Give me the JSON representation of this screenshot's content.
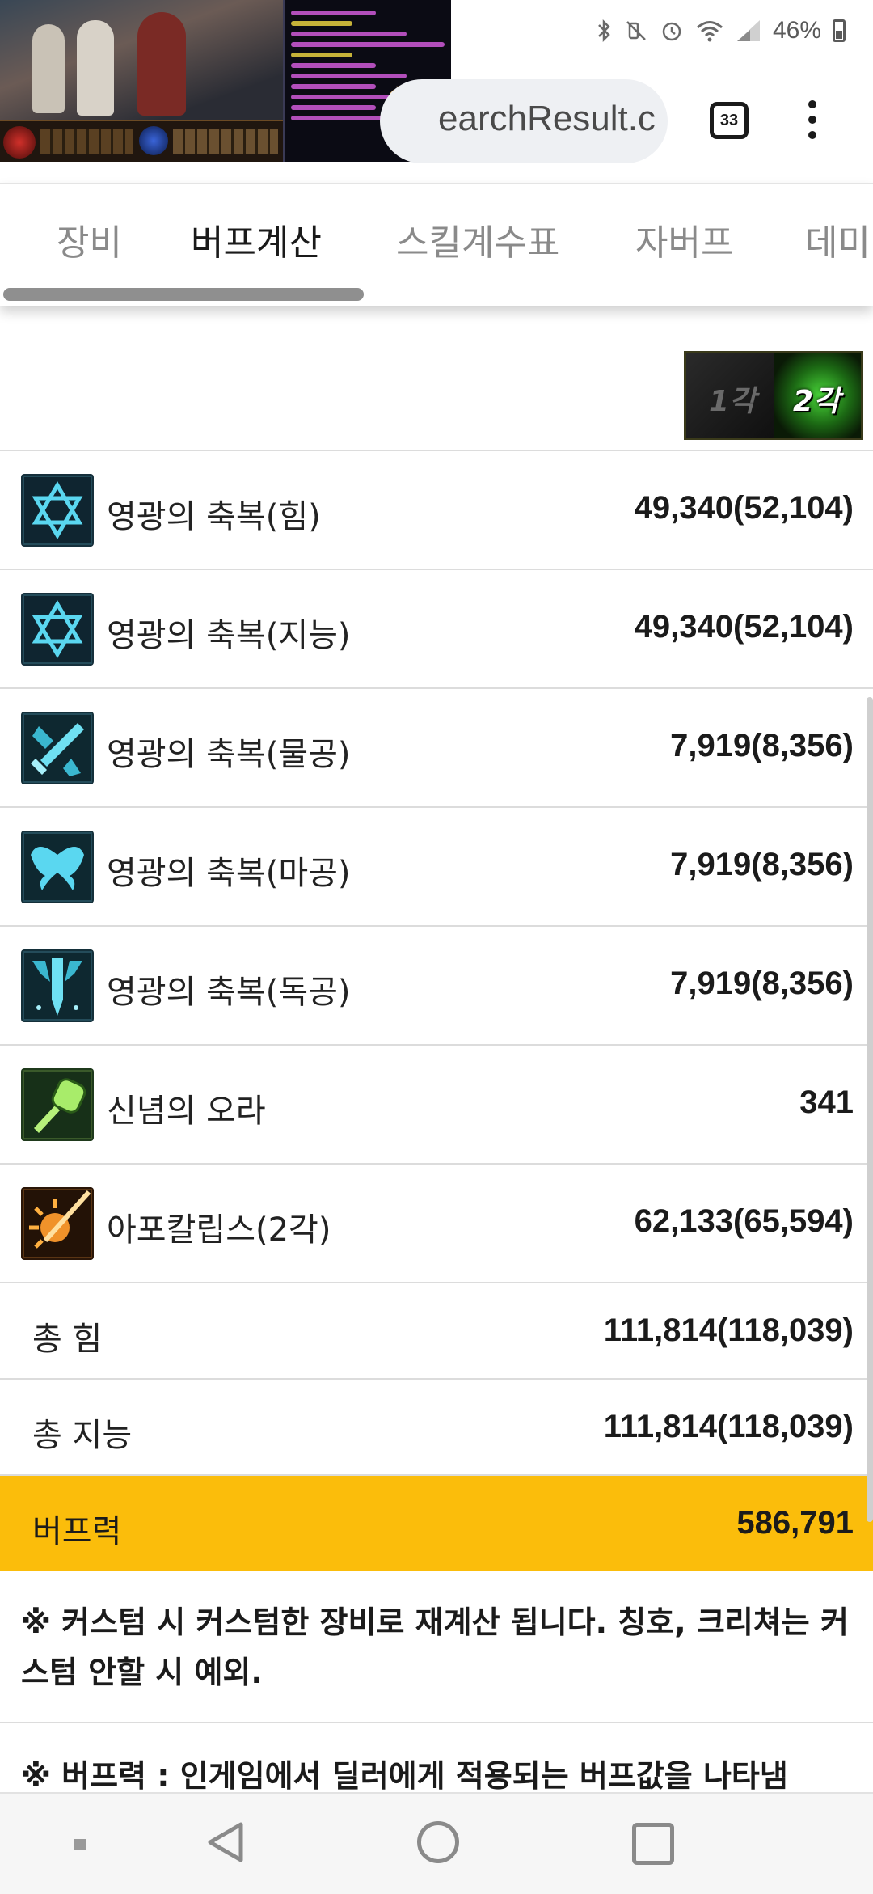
{
  "status_bar": {
    "battery_percent": "46%",
    "icons": [
      "bluetooth-icon",
      "mute-icon",
      "alarm-icon",
      "wifi-icon",
      "signal-icon",
      "battery-icon"
    ]
  },
  "browser": {
    "url_visible": "earchResult.c",
    "tab_count": "33"
  },
  "tabs": [
    {
      "label": "장비",
      "active": false
    },
    {
      "label": "버프계산",
      "active": true
    },
    {
      "label": "스킬계수표",
      "active": false
    },
    {
      "label": "자버프",
      "active": false
    },
    {
      "label": "데미",
      "active": false
    }
  ],
  "awakening_toggle": {
    "first": "1각",
    "second": "2각",
    "selected": "2각"
  },
  "buff_rows": [
    {
      "label": "영광의 축복(힘)",
      "value": "49,340(52,104)",
      "icon": "star-of-david-icon"
    },
    {
      "label": "영광의 축복(지능)",
      "value": "49,340(52,104)",
      "icon": "star-of-david-icon"
    },
    {
      "label": "영광의 축복(물공)",
      "value": "7,919(8,356)",
      "icon": "sword-icon"
    },
    {
      "label": "영광의 축복(마공)",
      "value": "7,919(8,356)",
      "icon": "wings-icon"
    },
    {
      "label": "영광의 축복(독공)",
      "value": "7,919(8,356)",
      "icon": "dagger-icon"
    },
    {
      "label": "신념의 오라",
      "value": "341",
      "icon": "fist-icon"
    },
    {
      "label": "아포칼립스(2각)",
      "value": "62,133(65,594)",
      "icon": "sun-burst-icon"
    }
  ],
  "totals": [
    {
      "label": "총 힘",
      "value": "111,814(118,039)"
    },
    {
      "label": "총 지능",
      "value": "111,814(118,039)"
    }
  ],
  "buff_power": {
    "label": "버프력",
    "value": "586,791",
    "color": "#fbbd0b"
  },
  "notes": {
    "custom": "※ 커스텀 시 커스텀한 장비로 재계산 됩니다. 칭호, 크리쳐는 커스텀 안할 시 예외.",
    "buff_power": "※ 버프력 : 인게임에서 딜러에게 적용되는 버프값을 나타냄"
  }
}
